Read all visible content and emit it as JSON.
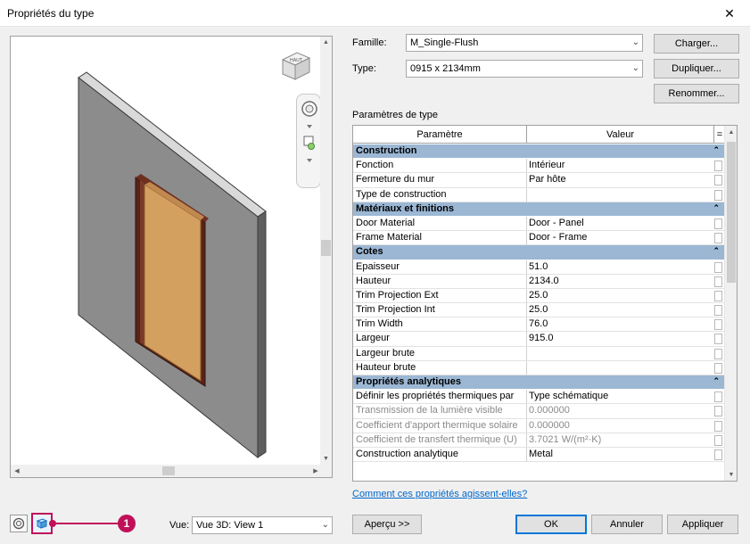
{
  "window": {
    "title": "Propriétés du type",
    "close_glyph": "✕"
  },
  "preview": {
    "viewcube_label": "HAUT"
  },
  "family": {
    "label": "Famille:",
    "value": "M_Single-Flush"
  },
  "type": {
    "label": "Type:",
    "value": "0915 x 2134mm"
  },
  "buttons": {
    "load": "Charger...",
    "duplicate": "Dupliquer...",
    "rename": "Renommer...",
    "preview": "Aperçu >>",
    "ok": "OK",
    "cancel": "Annuler",
    "apply": "Appliquer"
  },
  "type_params_label": "Paramètres de type",
  "table": {
    "headers": {
      "param": "Paramètre",
      "value": "Valeur",
      "eq": "="
    },
    "rows": [
      {
        "kind": "group",
        "param": "Construction"
      },
      {
        "kind": "row",
        "param": "Fonction",
        "value": "Intérieur"
      },
      {
        "kind": "row",
        "param": "Fermeture du mur",
        "value": "Par hôte"
      },
      {
        "kind": "row",
        "param": "Type de construction",
        "value": ""
      },
      {
        "kind": "group",
        "param": "Matériaux et finitions"
      },
      {
        "kind": "row",
        "param": "Door Material",
        "value": "Door - Panel"
      },
      {
        "kind": "row",
        "param": "Frame Material",
        "value": "Door - Frame"
      },
      {
        "kind": "group",
        "param": "Cotes"
      },
      {
        "kind": "row",
        "param": "Epaisseur",
        "value": "51.0"
      },
      {
        "kind": "row",
        "param": "Hauteur",
        "value": "2134.0"
      },
      {
        "kind": "row",
        "param": "Trim Projection Ext",
        "value": "25.0"
      },
      {
        "kind": "row",
        "param": "Trim Projection Int",
        "value": "25.0"
      },
      {
        "kind": "row",
        "param": "Trim Width",
        "value": "76.0"
      },
      {
        "kind": "row",
        "param": "Largeur",
        "value": "915.0"
      },
      {
        "kind": "row",
        "param": "Largeur brute",
        "value": ""
      },
      {
        "kind": "row",
        "param": "Hauteur brute",
        "value": ""
      },
      {
        "kind": "group",
        "param": "Propriétés analytiques"
      },
      {
        "kind": "row",
        "param": "Définir les propriétés thermiques par",
        "value": "Type schématique"
      },
      {
        "kind": "disabled",
        "param": "Transmission de la lumière visible",
        "value": "0.000000"
      },
      {
        "kind": "disabled",
        "param": "Coefficient d'apport thermique solaire",
        "value": "0.000000"
      },
      {
        "kind": "disabled",
        "param": "Coefficient de transfert thermique (U)",
        "value": "3.7021 W/(m²·K)"
      },
      {
        "kind": "row",
        "param": "Construction analytique",
        "value": "Metal"
      }
    ]
  },
  "help_link": "Comment ces propriétés agissent-elles?",
  "view": {
    "label": "Vue:",
    "value": "Vue 3D: View 1"
  },
  "annotation": {
    "badge": "1"
  },
  "colors": {
    "group_bg": "#9bb7d4",
    "annotation": "#c0105a",
    "link": "#0066cc"
  }
}
